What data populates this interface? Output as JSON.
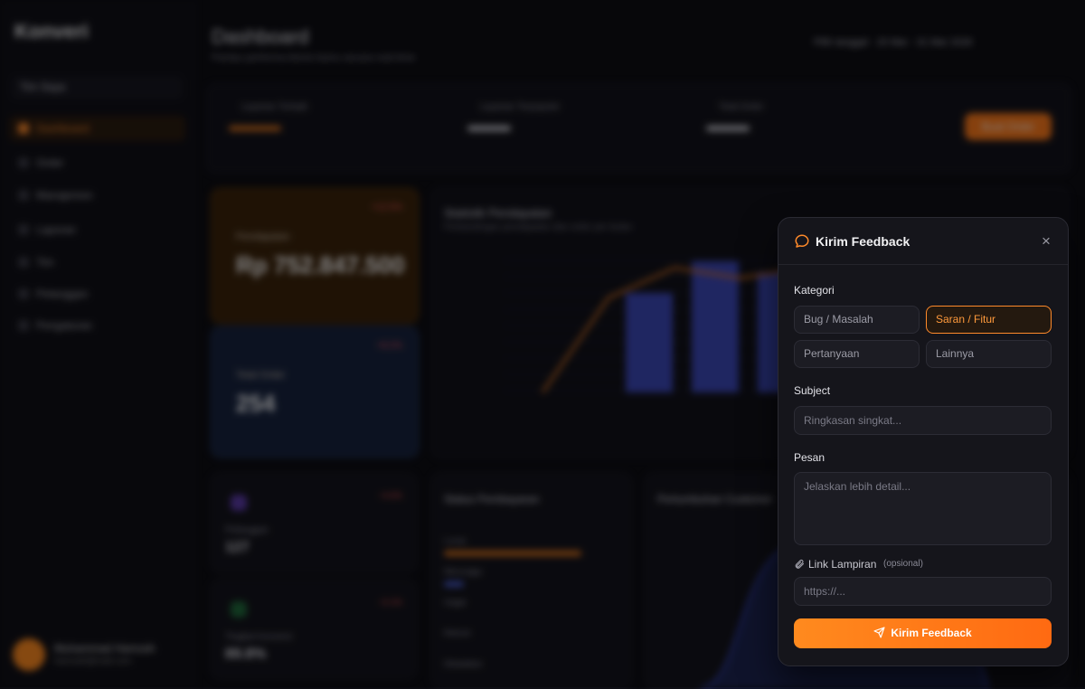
{
  "background": {
    "logo_text": "Konveri",
    "team_label": "Tim Saya",
    "nav": [
      {
        "label": "Dashboard",
        "active": true
      },
      {
        "label": "Order",
        "active": false
      },
      {
        "label": "Manajemen",
        "active": false
      },
      {
        "label": "Laporan",
        "active": false
      },
      {
        "label": "Tim",
        "active": false
      },
      {
        "label": "Pelanggan",
        "active": false
      },
      {
        "label": "Pengaturan",
        "active": false
      }
    ],
    "user": {
      "name": "Muhammad Hamzah",
      "email": "hamzah@mail.com"
    },
    "page_title": "Dashboard",
    "page_subtitle": "Pantau performa bisnis kamu secara real-time",
    "date_range": "Pilih tanggal · 20 Mar - 31 Mar 2026",
    "strip": {
      "col1": "Layanan Terbaik",
      "col2": "Layanan Terpopuler",
      "col3": "Total Order",
      "button": "Buat Order"
    },
    "cards": {
      "revenue_label": "Pendapatan",
      "revenue_value": "Rp 752.847.500",
      "revenue_badge": "+12.5%",
      "orders_label": "Total Order",
      "orders_value": "254",
      "orders_badge": "+8.2%"
    },
    "chart": {
      "title": "Statistik Pendapatan",
      "subtitle": "Perbandingan pendapatan dan order per bulan"
    },
    "small_cards": [
      {
        "label": "Pelanggan",
        "value": "127",
        "badge": "+4.6%"
      },
      {
        "label": "Tingkat Konversi",
        "value": "89.8%",
        "badge": "+2.1%"
      }
    ],
    "status": {
      "title": "Status Pembayaran",
      "rows": [
        "Lunas",
        "Menunggu",
        "Gagal",
        "Refund",
        "Dibatalkan"
      ]
    },
    "growth_title": "Pertumbuhan Customer"
  },
  "modal": {
    "title": "Kirim Feedback",
    "category_label": "Kategori",
    "categories": [
      {
        "label": "Bug / Masalah",
        "selected": false
      },
      {
        "label": "Saran / Fitur",
        "selected": true
      },
      {
        "label": "Pertanyaan",
        "selected": false
      },
      {
        "label": "Lainnya",
        "selected": false
      }
    ],
    "subject_label": "Subject",
    "subject_placeholder": "Ringkasan singkat...",
    "subject_value": "",
    "message_label": "Pesan",
    "message_placeholder": "Jelaskan lebih detail...",
    "message_value": "",
    "link_label": "Link Lampiran",
    "link_optional": "(opsional)",
    "link_placeholder": "https://...",
    "link_value": "",
    "submit_label": "Kirim Feedback",
    "close_symbol": "×"
  },
  "colors": {
    "accent": "#ff8a2a",
    "modal_bg": "#15151b",
    "bg": "#0b0b10"
  },
  "chart_data": {
    "type": "bar",
    "categories": [
      "",
      "",
      "",
      "",
      "",
      "",
      "",
      ""
    ],
    "series": [
      {
        "name": "",
        "values": [
          0,
          110,
          145,
          133,
          145,
          125,
          0,
          0
        ]
      }
    ]
  }
}
